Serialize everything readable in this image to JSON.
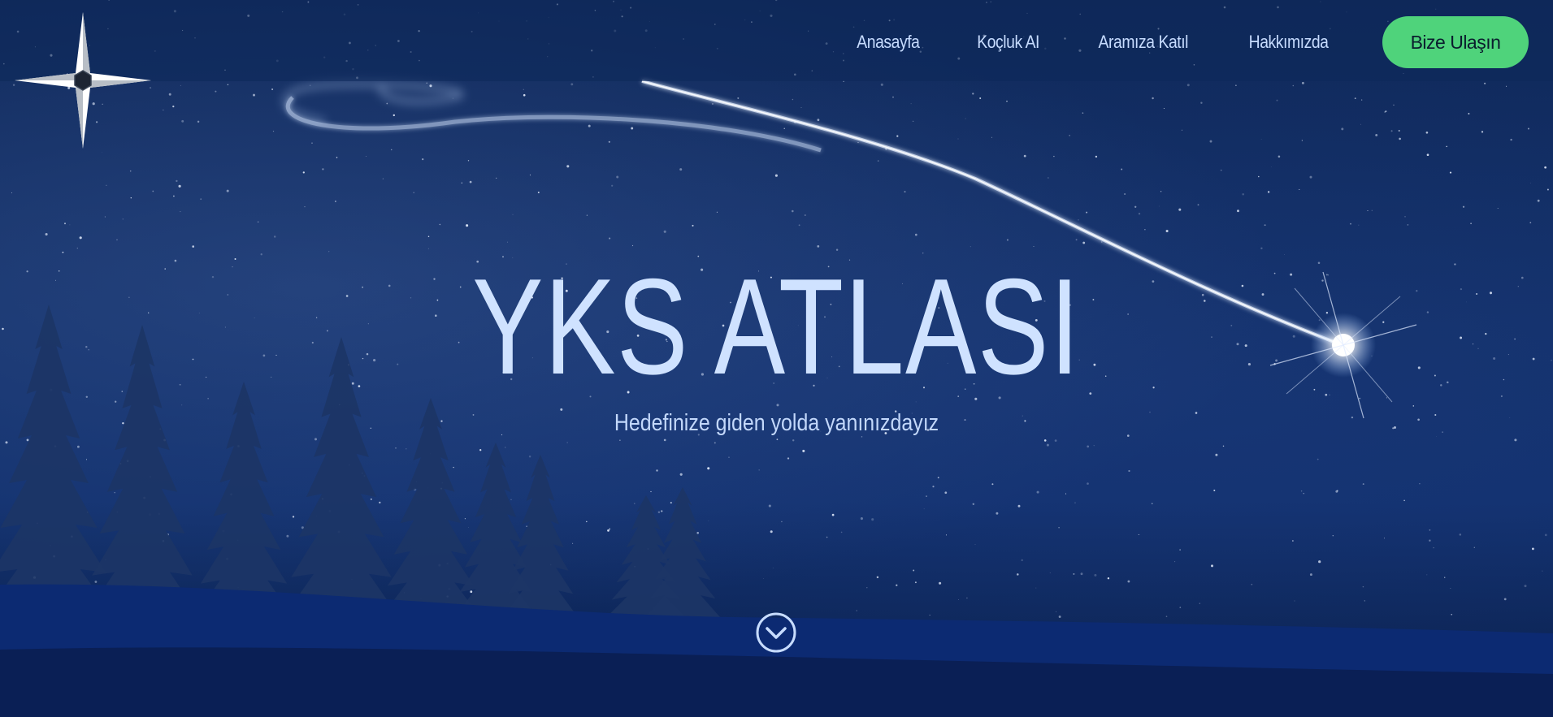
{
  "brand": {
    "logo_icon": "compass-star-icon"
  },
  "nav": {
    "items": [
      {
        "label": "Anasayfa"
      },
      {
        "label": "Koçluk AI"
      },
      {
        "label": "Aramıza Katıl"
      },
      {
        "label": "Hakkımızda"
      }
    ],
    "cta_label": "Bize Ulaşın"
  },
  "hero": {
    "title": "YKS ATLASI",
    "subtitle": "Hedefinize giden yolda yanınızdayız",
    "scroll_icon": "chevron-down-circle-icon"
  },
  "colors": {
    "background": "#10295a",
    "text": "#cfe2ff",
    "cta": "#4fd37b",
    "cta_text": "#0b1d2e"
  }
}
